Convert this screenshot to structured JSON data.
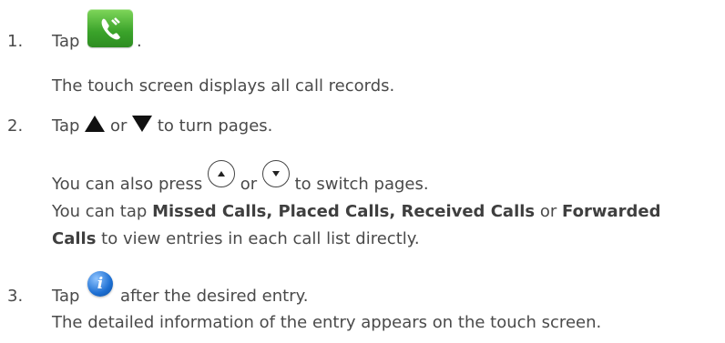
{
  "steps": [
    {
      "number": "1.",
      "text_before_icon": "Tap",
      "text_after_icon": ".",
      "icon": "call-history-phone-icon",
      "result": "The touch screen displays all call records."
    },
    {
      "number": "2.",
      "tap_text": "Tap",
      "or_text": "or",
      "turn_pages_text": "to turn pages.",
      "icons": [
        "up-triangle-icon",
        "down-triangle-icon"
      ],
      "press_intro": "You can also press",
      "press_or": "or",
      "press_suffix": "to switch pages.",
      "press_icons": [
        "up-navigation-key-icon",
        "down-navigation-key-icon"
      ],
      "lists_intro": "You can tap",
      "lists_bold_1": "Missed Calls, Placed Calls, Received Calls",
      "lists_or": "or",
      "lists_bold_2a": "Forwarded",
      "lists_bold_2b": "Calls",
      "lists_suffix": "to view entries in each call list  directly."
    },
    {
      "number": "3.",
      "text_before_icon": "Tap",
      "text_after_icon": "after the desired entry.",
      "icon": "info-icon",
      "result": "The detailed information of the entry appears on the touch screen."
    }
  ]
}
